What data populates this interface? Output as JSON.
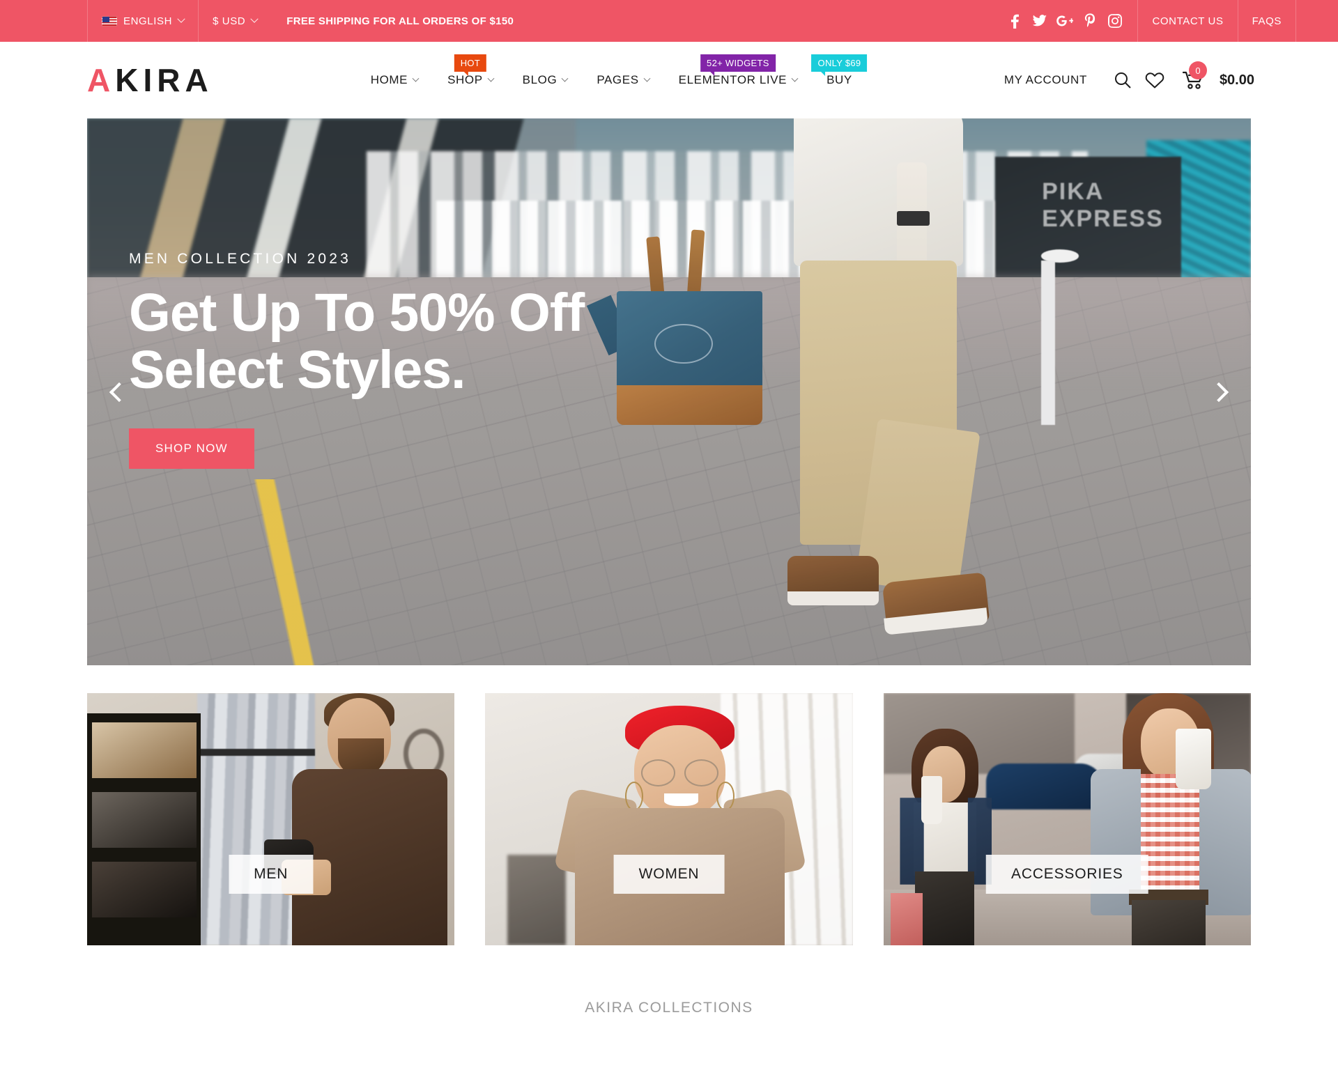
{
  "topbar": {
    "language": {
      "label": "ENGLISH",
      "icon": "us-flag-icon"
    },
    "currency": {
      "label": "$ USD"
    },
    "shipping_message": "FREE SHIPPING FOR ALL ORDERS OF $150",
    "social": [
      {
        "name": "facebook-icon"
      },
      {
        "name": "twitter-icon"
      },
      {
        "name": "google-plus-icon"
      },
      {
        "name": "pinterest-icon"
      },
      {
        "name": "instagram-icon"
      }
    ],
    "links": [
      {
        "label": "CONTACT US"
      },
      {
        "label": "FAQS"
      }
    ],
    "background_color": "#ef5565"
  },
  "header": {
    "logo": {
      "accent_letter": "A",
      "rest": "KIRA",
      "accent_color": "#ef5565"
    },
    "nav": [
      {
        "label": "HOME",
        "has_dropdown": true,
        "badge": null
      },
      {
        "label": "SHOP",
        "has_dropdown": true,
        "badge": {
          "text": "HOT",
          "color": "#e8490f"
        }
      },
      {
        "label": "BLOG",
        "has_dropdown": true,
        "badge": null
      },
      {
        "label": "PAGES",
        "has_dropdown": true,
        "badge": null
      },
      {
        "label": "ELEMENTOR LIVE",
        "has_dropdown": true,
        "badge": {
          "text": "52+ WIDGETS",
          "color": "#8224a8"
        }
      },
      {
        "label": "BUY",
        "has_dropdown": false,
        "badge": {
          "text": "ONLY $69",
          "color": "#19cdda"
        }
      }
    ],
    "account_label": "MY ACCOUNT",
    "icons": [
      {
        "name": "search-icon"
      },
      {
        "name": "wishlist-heart-icon"
      },
      {
        "name": "shopping-cart-icon"
      }
    ],
    "cart": {
      "count": "0",
      "total": "$0.00"
    }
  },
  "hero": {
    "subtitle": "MEN COLLECTION 2023",
    "title_line1": "Get Up To 50% Off",
    "title_line2": "Select Styles.",
    "cta_label": "SHOP NOW",
    "cta_color": "#ef5565",
    "prev_label": "Previous slide",
    "next_label": "Next slide"
  },
  "categories": [
    {
      "label": "MEN"
    },
    {
      "label": "WOMEN"
    },
    {
      "label": "ACCESSORIES"
    }
  ],
  "collections": {
    "title": "AKIRA COLLECTIONS"
  }
}
